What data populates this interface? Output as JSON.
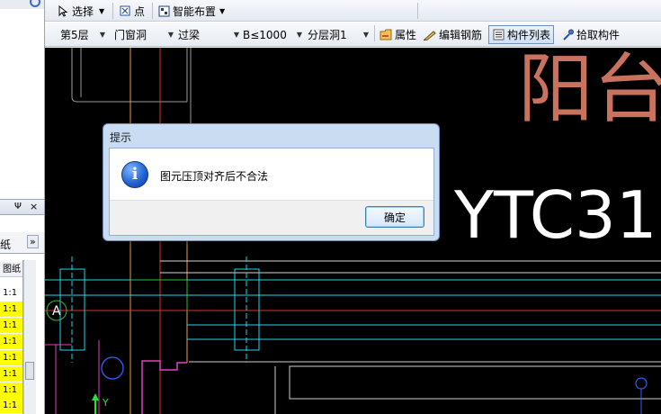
{
  "toolbar1": {
    "select_label": "选择",
    "point_label": "点",
    "smart_layout_label": "智能布置"
  },
  "toolbar2": {
    "floor": "第5层",
    "category": "门窗洞",
    "type": "过梁",
    "spec": "B≤1000",
    "layer": "分层洞1",
    "property_label": "属性",
    "edit_rebar_label": "编辑钢筋",
    "component_list_label": "构件列表",
    "pick_component_label": "拾取构件"
  },
  "left_panel": {
    "pin_glyph": "Ψ",
    "close_glyph": "×",
    "tab_label": "纸",
    "more_glyph": "»",
    "column_header": "图纸",
    "rows": [
      "1:1",
      "1:1",
      "1:1",
      "1:1",
      "1:1",
      "1:1",
      "1:1",
      "1:1"
    ]
  },
  "canvas": {
    "big_text_1": "阳台",
    "big_text_2": "YTC31",
    "axis_label": "A",
    "y_axis_label": "Y"
  },
  "dialog": {
    "title": "提示",
    "icon": "info-icon",
    "message": "图元压顶对齐后不合法",
    "ok_label": "确定"
  },
  "colors": {
    "canvas_bg": "#000000",
    "dialog_frame": "#c9dcf2",
    "highlight_yellow": "#ffff00",
    "red_text": "#c9735f"
  }
}
